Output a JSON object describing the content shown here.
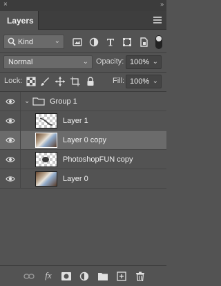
{
  "window": {
    "close_glyph": "×",
    "collapse_glyph": "»"
  },
  "panel": {
    "tab_label": "Layers",
    "menu_icon": "panel-menu-icon"
  },
  "filter": {
    "kind_label": "Kind",
    "icons": [
      "pixel-filter-icon",
      "adjustment-filter-icon",
      "type-filter-icon",
      "shape-filter-icon",
      "smart-object-filter-icon"
    ]
  },
  "blend": {
    "mode": "Normal",
    "opacity_label": "Opacity:",
    "opacity_value": "100%"
  },
  "lock": {
    "label": "Lock:",
    "icons": [
      "lock-transparent-pixels-icon",
      "lock-image-pixels-icon",
      "lock-position-icon",
      "lock-artboard-icon",
      "lock-all-icon"
    ],
    "fill_label": "Fill:",
    "fill_value": "100%"
  },
  "layers": [
    {
      "name": "Group 1",
      "type": "group",
      "visible": true,
      "selected": false
    },
    {
      "name": "Layer 1",
      "type": "layer",
      "visible": true,
      "selected": false,
      "thumb": "transparent"
    },
    {
      "name": "Layer 0 copy",
      "type": "layer",
      "visible": true,
      "selected": true,
      "thumb": "photo"
    },
    {
      "name": "PhotoshopFUN copy",
      "type": "layer",
      "visible": true,
      "selected": false,
      "thumb": "transparent"
    },
    {
      "name": "Layer 0",
      "type": "layer",
      "visible": true,
      "selected": false,
      "thumb": "photo"
    }
  ],
  "bottom_icons": [
    "link-layers-icon",
    "fx-icon",
    "add-mask-icon",
    "new-adjustment-layer-icon",
    "new-group-icon",
    "new-layer-icon",
    "delete-layer-icon"
  ],
  "colors": {
    "panel_bg": "#535353",
    "selected_row": "#6b6b6b"
  }
}
